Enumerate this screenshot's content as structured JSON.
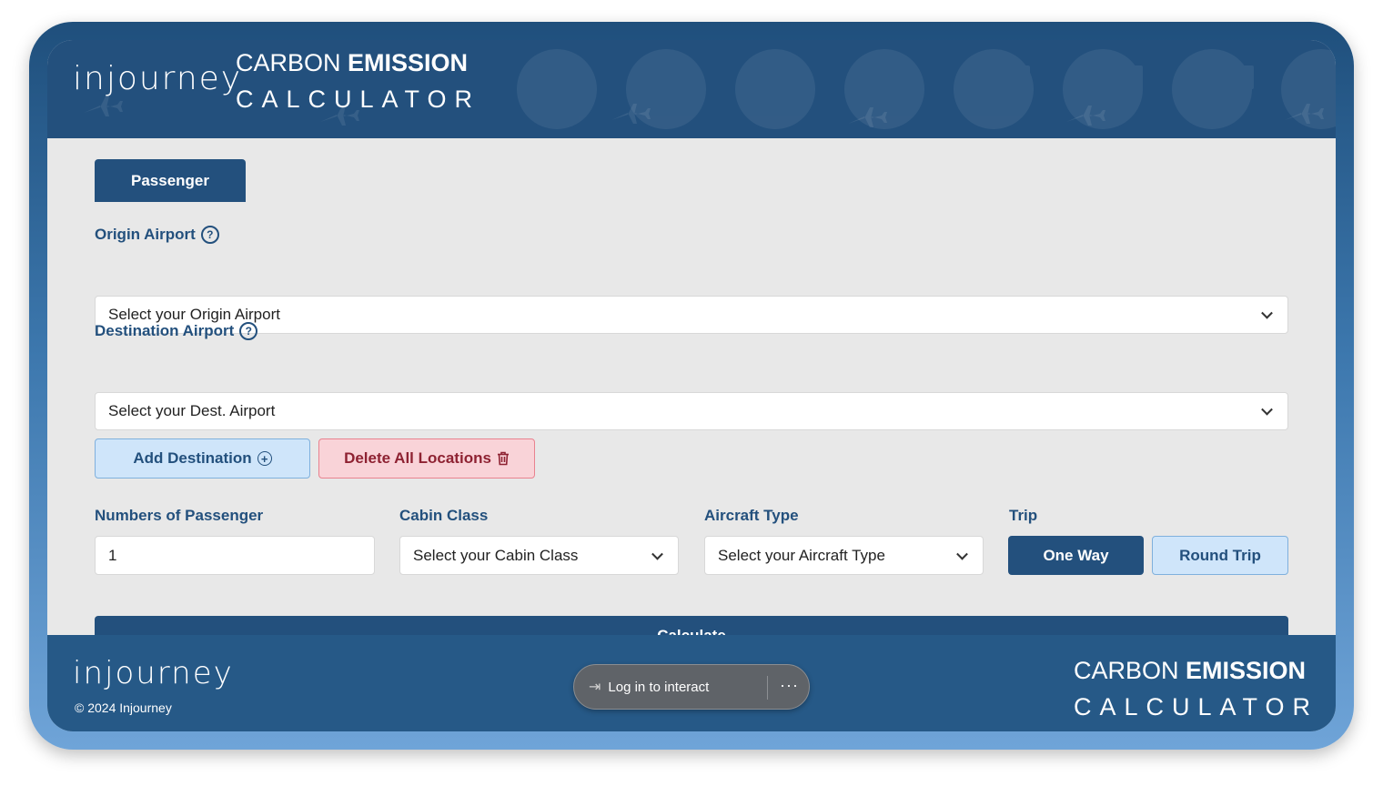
{
  "header": {
    "logo": "injourney",
    "title_light": "CARBON ",
    "title_bold": "EMISSION",
    "subtitle": "CALCULATOR"
  },
  "tabs": [
    {
      "label": "Passenger",
      "active": true
    }
  ],
  "origin": {
    "label": "Origin Airport",
    "help_icon": "question-circle-icon",
    "placeholder": "Select your Origin Airport"
  },
  "destination": {
    "label": "Destination Airport",
    "help_icon": "question-circle-icon",
    "placeholder": "Select your Dest. Airport"
  },
  "actions": {
    "add_destination": "Add Destination",
    "add_icon": "plus-circle-icon",
    "delete_all": "Delete All Locations",
    "delete_icon": "trash-icon"
  },
  "passengers": {
    "label": "Numbers of Passenger",
    "value": "1"
  },
  "cabin_class": {
    "label": "Cabin Class",
    "placeholder": "Select your Cabin Class"
  },
  "aircraft_type": {
    "label": "Aircraft Type",
    "placeholder": "Select your Aircraft Type"
  },
  "trip": {
    "label": "Trip",
    "one_way": "One Way",
    "round_trip": "Round Trip",
    "selected": "One Way"
  },
  "calculate": "Calculate",
  "footer": {
    "logo": "injourney",
    "copyright": "© 2024 Injourney",
    "title_light": "CARBON ",
    "title_bold": "EMISSION",
    "subtitle": "CALCULATOR"
  },
  "overlay": {
    "login": "Log in to interact",
    "login_icon": "login-arrow-icon",
    "more_icon": "more-dots-icon"
  },
  "colors": {
    "primary": "#23507d",
    "light_blue": "#cfe5fa",
    "danger_bg": "#f9d3d8",
    "danger_text": "#8e2232",
    "background": "#e8e8e8"
  }
}
